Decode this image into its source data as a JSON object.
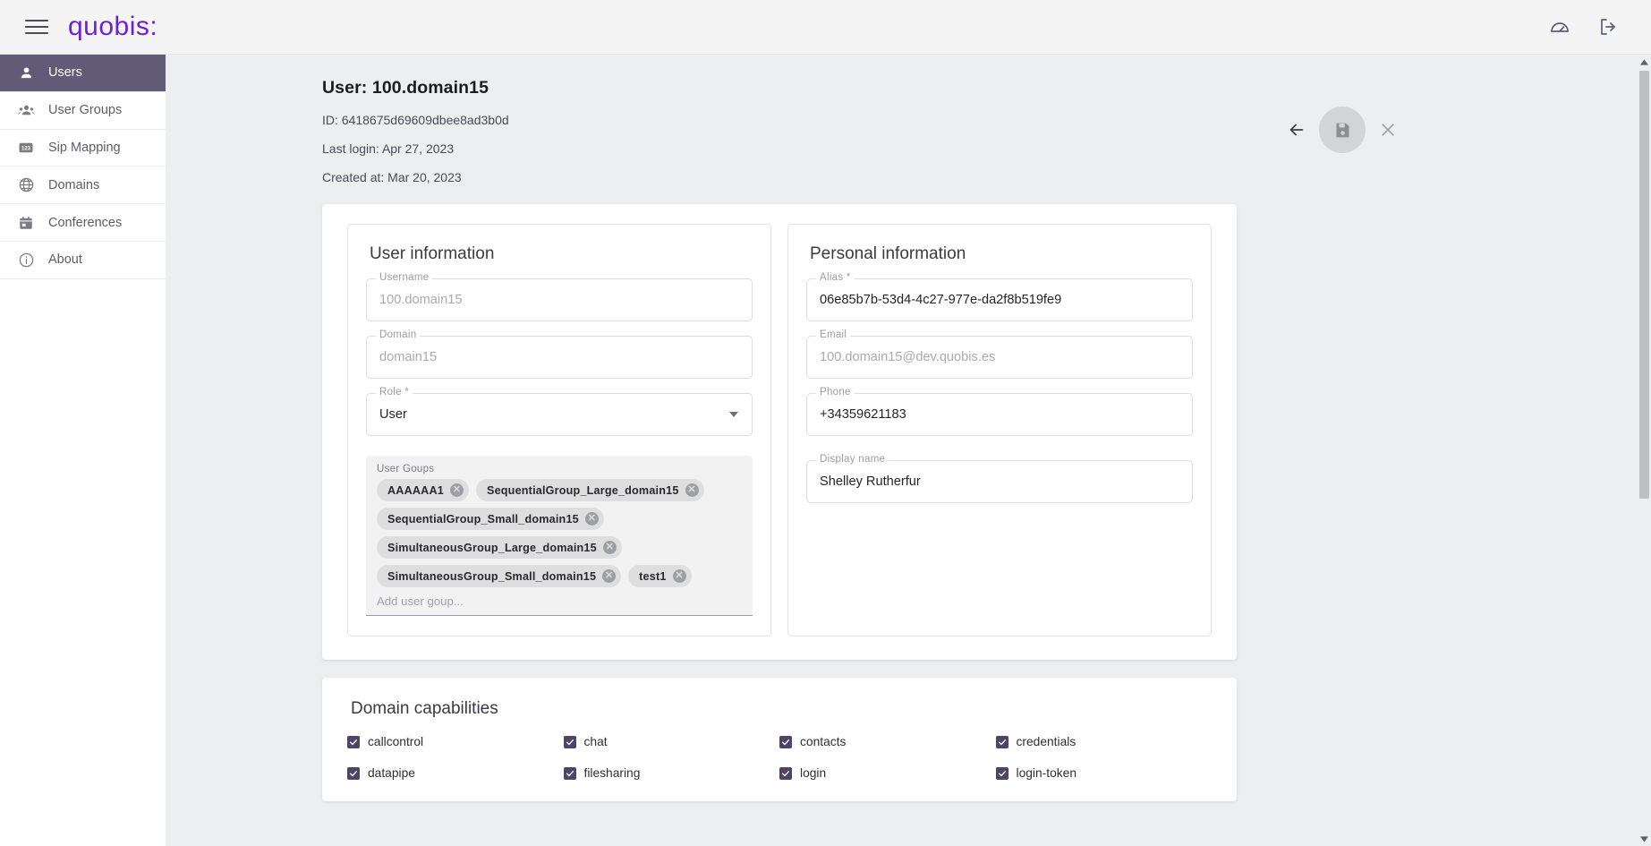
{
  "topbar": {
    "brand": "quobis:",
    "menu_icon": "hamburger-icon",
    "dashboard_icon": "speedometer-icon",
    "logout_icon": "logout-icon"
  },
  "sidebar": {
    "items": [
      {
        "label": "Users",
        "icon": "person-icon",
        "active": true
      },
      {
        "label": "User Groups",
        "icon": "people-icon",
        "active": false
      },
      {
        "label": "Sip Mapping",
        "icon": "numbers-icon",
        "active": false
      },
      {
        "label": "Domains",
        "icon": "globe-icon",
        "active": false
      },
      {
        "label": "Conferences",
        "icon": "calendar-icon",
        "active": false
      },
      {
        "label": "About",
        "icon": "info-icon",
        "active": false
      }
    ]
  },
  "header": {
    "title": "User: 100.domain15",
    "id_line": "ID: 6418675d69609dbee8ad3b0d",
    "last_login_line": "Last login: Apr 27, 2023",
    "created_line": "Created at: Mar 20, 2023",
    "actions": {
      "back_label": "back-arrow",
      "save_label": "save",
      "close_label": "close"
    }
  },
  "user_information": {
    "title": "User information",
    "username": {
      "label": "Username",
      "value": "100.domain15",
      "disabled": true
    },
    "domain": {
      "label": "Domain",
      "value": "domain15",
      "disabled": true
    },
    "role": {
      "label": "Role *",
      "value": "User",
      "disabled": false
    },
    "user_groups": {
      "label": "User Goups",
      "placeholder": "Add user goup...",
      "chips": [
        "AAAAAA1",
        "SequentialGroup_Large_domain15",
        "SequentialGroup_Small_domain15",
        "SimultaneousGroup_Large_domain15",
        "SimultaneousGroup_Small_domain15",
        "test1"
      ]
    }
  },
  "personal_information": {
    "title": "Personal information",
    "alias": {
      "label": "Alias *",
      "value": "06e85b7b-53d4-4c27-977e-da2f8b519fe9",
      "disabled": false
    },
    "email": {
      "label": "Email",
      "value": "100.domain15@dev.quobis.es",
      "disabled": true
    },
    "phone": {
      "label": "Phone",
      "value": "+34359621183",
      "disabled": false
    },
    "display_name": {
      "label": "Display name",
      "value": "Shelley Rutherfur",
      "disabled": false
    }
  },
  "domain_capabilities": {
    "title": "Domain capabilities",
    "items": [
      {
        "label": "callcontrol",
        "checked": true
      },
      {
        "label": "chat",
        "checked": true
      },
      {
        "label": "contacts",
        "checked": true
      },
      {
        "label": "credentials",
        "checked": true
      },
      {
        "label": "datapipe",
        "checked": true
      },
      {
        "label": "filesharing",
        "checked": true
      },
      {
        "label": "login",
        "checked": true
      },
      {
        "label": "login-token",
        "checked": true
      }
    ]
  },
  "colors": {
    "brand_purple": "#6d20d8",
    "sidebar_active": "#625b77",
    "checkbox_fill": "#4f4366",
    "page_bg": "#eceeef",
    "topbar_bg": "#f4f4f5"
  }
}
